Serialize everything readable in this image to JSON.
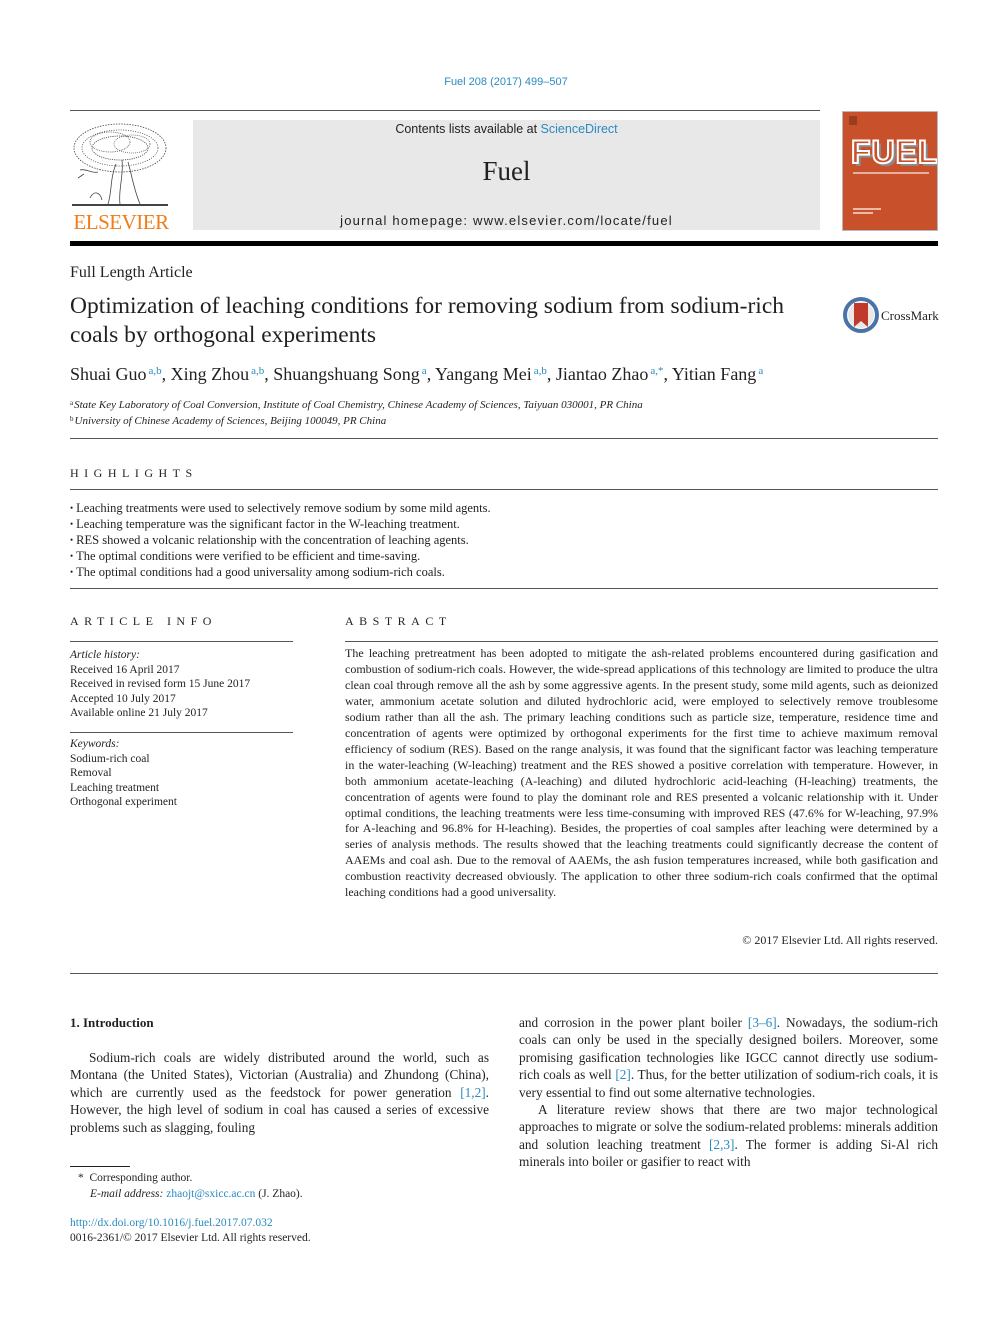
{
  "header": {
    "journal_ref": "Fuel 208 (2017) 499–507",
    "contents_prefix": "Contents lists available at ",
    "contents_link": "ScienceDirect",
    "journal_name": "Fuel",
    "homepage_line": "journal homepage: www.elsevier.com/locate/fuel",
    "publisher_logo_text": "ELSEVIER",
    "cover_title": "FUEL",
    "colors": {
      "link": "#2a8bc0",
      "elsevier_orange": "#f07c1a",
      "cover": "#c8502a"
    }
  },
  "article": {
    "type": "Full Length Article",
    "title": "Optimization of leaching conditions for removing sodium from sodium-rich coals by orthogonal experiments",
    "crossmark_label": "CrossMark",
    "authors": [
      {
        "name": "Shuai Guo",
        "affil": "a,b"
      },
      {
        "name": "Xing Zhou",
        "affil": "a,b"
      },
      {
        "name": "Shuangshuang Song",
        "affil": "a"
      },
      {
        "name": "Yangang Mei",
        "affil": "a,b"
      },
      {
        "name": "Jiantao Zhao",
        "affil": "a,*"
      },
      {
        "name": "Yitian Fang",
        "affil": "a"
      }
    ],
    "affiliations": [
      {
        "mark": "a",
        "text": "State Key Laboratory of Coal Conversion, Institute of Coal Chemistry, Chinese Academy of Sciences, Taiyuan 030001, PR China"
      },
      {
        "mark": "b",
        "text": "University of Chinese Academy of Sciences, Beijing 100049, PR China"
      }
    ]
  },
  "highlights": {
    "heading": "HIGHLIGHTS",
    "items": [
      "Leaching treatments were used to selectively remove sodium by some mild agents.",
      "Leaching temperature was the significant factor in the W-leaching treatment.",
      "RES showed a volcanic relationship with the concentration of leaching agents.",
      "The optimal conditions were verified to be efficient and time-saving.",
      "The optimal conditions had a good universality among sodium-rich coals."
    ]
  },
  "article_info": {
    "heading": "ARTICLE INFO",
    "history_label": "Article history:",
    "history": [
      "Received 16 April 2017",
      "Received in revised form 15 June 2017",
      "Accepted 10 July 2017",
      "Available online 21 July 2017"
    ],
    "keywords_label": "Keywords:",
    "keywords": [
      "Sodium-rich coal",
      "Removal",
      "Leaching treatment",
      "Orthogonal experiment"
    ]
  },
  "abstract": {
    "heading": "ABSTRACT",
    "text": "The leaching pretreatment has been adopted to mitigate the ash-related problems encountered during gasification and combustion of sodium-rich coals. However, the wide-spread applications of this technology are limited to produce the ultra clean coal through remove all the ash by some aggressive agents. In the present study, some mild agents, such as deionized water, ammonium acetate solution and diluted hydrochloric acid, were employed to selectively remove troublesome sodium rather than all the ash. The primary leaching conditions such as particle size, temperature, residence time and concentration of agents were optimized by orthogonal experiments for the first time to achieve maximum removal efficiency of sodium (RES). Based on the range analysis, it was found that the significant factor was leaching temperature in the water-leaching (W-leaching) treatment and the RES showed a positive correlation with temperature. However, in both ammonium acetate-leaching (A-leaching) and diluted hydrochloric acid-leaching (H-leaching) treatments, the concentration of agents were found to play the dominant role and RES presented a volcanic relationship with it. Under optimal conditions, the leaching treatments were less time-consuming with improved RES (47.6% for W-leaching, 97.9% for A-leaching and 96.8% for H-leaching). Besides, the properties of coal samples after leaching were determined by a series of analysis methods. The results showed that the leaching treatments could significantly decrease the content of AAEMs and coal ash. Due to the removal of AAEMs, the ash fusion temperatures increased, while both gasification and combustion reactivity decreased obviously. The application to other three sodium-rich coals confirmed that the optimal leaching conditions had a good universality.",
    "copyright": "© 2017 Elsevier Ltd. All rights reserved."
  },
  "intro": {
    "heading": "1. Introduction",
    "p1_a": "Sodium-rich coals are widely distributed around the world, such as Montana (the United States), Victorian (Australia) and Zhundong (China), which are currently used as the feedstock for power generation ",
    "p1_ref1": "[1,2]",
    "p1_b": ". However, the high level of sodium in coal has caused a series of excessive problems such as slagging, fouling",
    "p1_c": "and corrosion in the power plant boiler ",
    "p1_ref2": "[3–6]",
    "p1_d": ". Nowadays, the sodium-rich coals can only be used in the specially designed boilers. Moreover, some promising gasification technologies like IGCC cannot directly use sodium-rich coals as well ",
    "p1_ref3": "[2]",
    "p1_e": ". Thus, for the better utilization of sodium-rich coals, it is very essential to find out some alternative technologies.",
    "p2_a": "A literature review shows that there are two major technological approaches to migrate or solve the sodium-related problems: minerals addition and solution leaching treatment ",
    "p2_ref": "[2,3]",
    "p2_b": ". The former is adding Si-Al rich minerals into boiler or gasifier to react with"
  },
  "footnotes": {
    "star": "*",
    "corresponding": "Corresponding author.",
    "email_label": "E-mail address:",
    "email": "zhaojt@sxicc.ac.cn",
    "email_owner": " (J. Zhao).",
    "doi": "http://dx.doi.org/10.1016/j.fuel.2017.07.032",
    "issn": "0016-2361/© 2017 Elsevier Ltd. All rights reserved."
  }
}
